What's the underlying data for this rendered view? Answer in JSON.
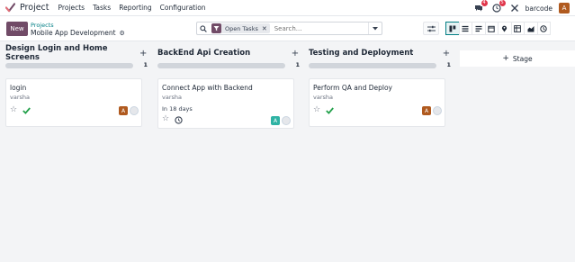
{
  "navbar": {
    "app_name": "Project",
    "menu": [
      "Projects",
      "Tasks",
      "Reporting",
      "Configuration"
    ],
    "messages_badge": "4",
    "activities_badge": "5",
    "company": "barcode",
    "user_initial": "A"
  },
  "control_panel": {
    "new_label": "New",
    "breadcrumb_parent": "Projects",
    "breadcrumb_current": "Mobile App Development",
    "search": {
      "facet_label": "Open Tasks",
      "placeholder": "Search..."
    }
  },
  "columns": [
    {
      "title": "Design Login and Home Screens",
      "count": "1",
      "card": {
        "title": "login",
        "assignee": "varsha",
        "deadline": "",
        "state": "done",
        "avatar_initial": "A",
        "avatar_color": "#b05a1f"
      }
    },
    {
      "title": "BackEnd Api Creation",
      "count": "1",
      "card": {
        "title": "Connect App with Backend",
        "assignee": "varsha",
        "deadline": "In 18 days",
        "state": "in-progress",
        "avatar_initial": "A",
        "avatar_color": "#2fb3a4"
      }
    },
    {
      "title": "Testing and Deployment",
      "count": "1",
      "card": {
        "title": "Perform QA and Deploy",
        "assignee": "varsha",
        "deadline": "",
        "state": "done",
        "avatar_initial": "A",
        "avatar_color": "#b05a1f"
      }
    }
  ],
  "stage_button": "Stage",
  "colors": {
    "brand": "#714b67",
    "link": "#017e84",
    "badge": "#e0364b",
    "done_check": "#22a04a"
  }
}
